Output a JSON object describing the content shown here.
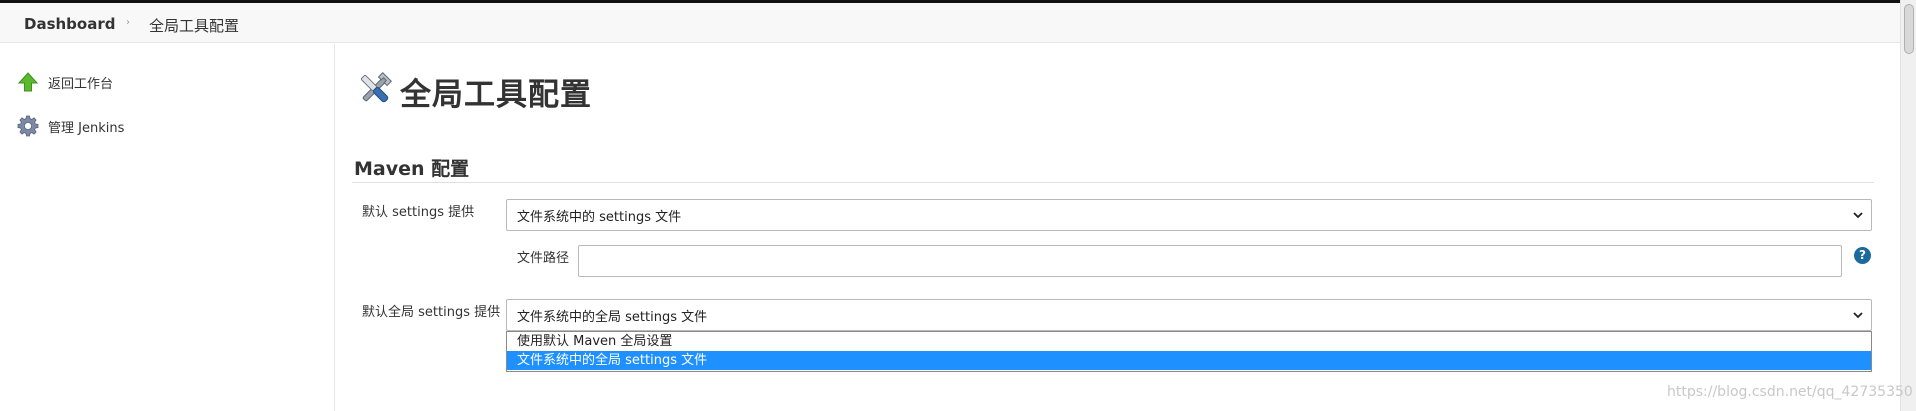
{
  "breadcrumb": {
    "root": "Dashboard",
    "separator": "›",
    "current": "全局工具配置"
  },
  "sidebar": {
    "items": [
      {
        "label": "返回工作台",
        "icon": "up-arrow-icon"
      },
      {
        "label": "管理 Jenkins",
        "icon": "gear-icon"
      }
    ]
  },
  "page": {
    "title": "全局工具配置",
    "title_icon": "tools-icon"
  },
  "maven": {
    "section_title": "Maven 配置",
    "default_settings_label": "默认 settings 提供",
    "default_settings_value": "文件系统中的 settings 文件",
    "file_path_label": "文件路径",
    "file_path_value": "",
    "help_label": "?",
    "global_settings_label": "默认全局 settings 提供",
    "global_settings_value": "文件系统中的全局 settings 文件",
    "global_options": [
      {
        "label": "使用默认 Maven 全局设置",
        "selected": false
      },
      {
        "label": "文件系统中的全局 settings 文件",
        "selected": true
      }
    ]
  },
  "watermark": "https://blog.csdn.net/qq_42735350",
  "colors": {
    "accent": "#1e90ff",
    "help": "#1b6a9e",
    "arrow_green": "#5cb82e"
  }
}
